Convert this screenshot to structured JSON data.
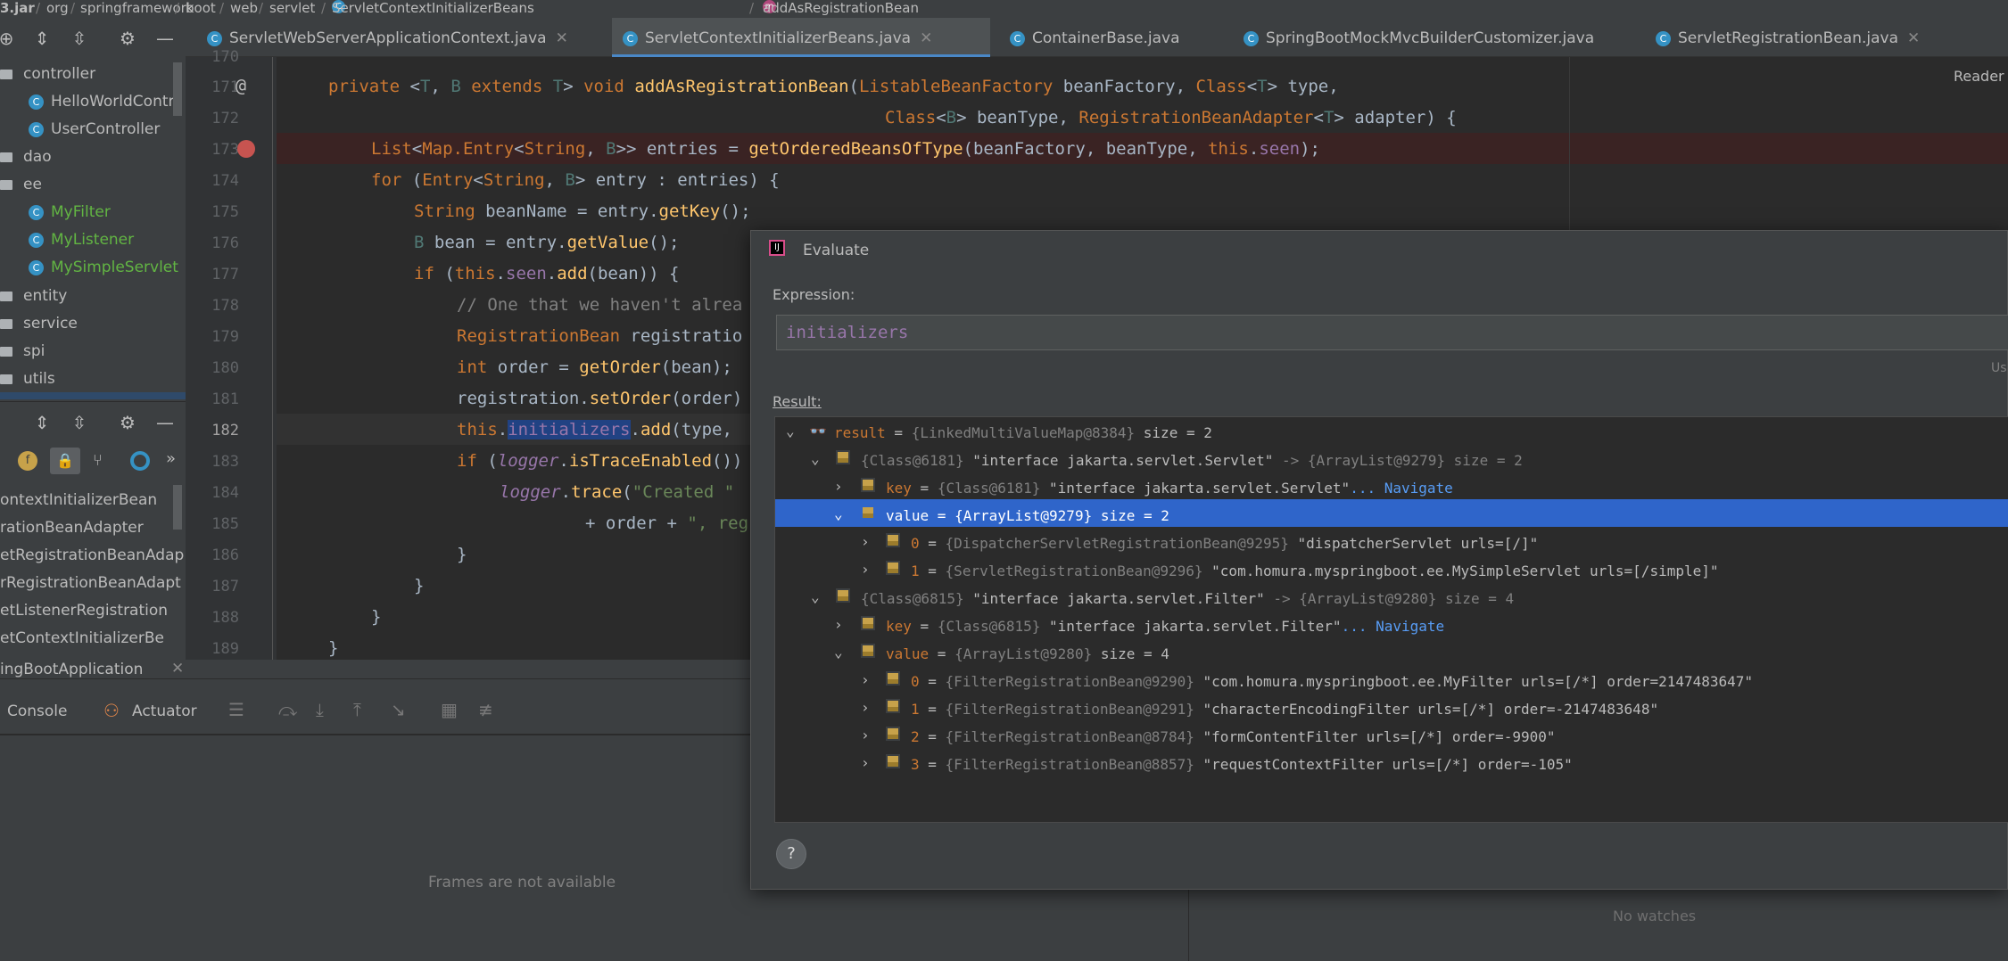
{
  "breadcrumb": {
    "items": [
      "3.jar",
      "org",
      "springframework",
      "boot",
      "web",
      "servlet",
      "ServletContextInitializerBeans",
      "addAsRegistrationBean"
    ]
  },
  "tabs": [
    {
      "label": "ServletWebServerApplicationContext.java"
    },
    {
      "label": "ServletContextInitializerBeans.java"
    },
    {
      "label": "ContainerBase.java"
    },
    {
      "label": "SpringBootMockMvcBuilderCustomizer.java"
    },
    {
      "label": "ServletRegistrationBean.java"
    }
  ],
  "project_tree": {
    "items": [
      {
        "label": "controller",
        "kind": "folder"
      },
      {
        "label": "HelloWorldContr",
        "kind": "class"
      },
      {
        "label": "UserController",
        "kind": "class"
      },
      {
        "label": "dao",
        "kind": "folder"
      },
      {
        "label": "ee",
        "kind": "folder"
      },
      {
        "label": "MyFilter",
        "kind": "class"
      },
      {
        "label": "MyListener",
        "kind": "class"
      },
      {
        "label": "MySimpleServlet",
        "kind": "class"
      },
      {
        "label": "entity",
        "kind": "folder"
      },
      {
        "label": "service",
        "kind": "folder"
      },
      {
        "label": "spi",
        "kind": "folder"
      },
      {
        "label": "utils",
        "kind": "folder"
      }
    ]
  },
  "structure": {
    "items": [
      "ontextInitializerBean",
      "rationBeanAdapter",
      "etRegistrationBeanAdap",
      "rRegistrationBeanAdapt",
      "etListenerRegistration",
      "etContextInitializerBe"
    ]
  },
  "editor": {
    "line_numbers": [
      "170",
      "171",
      "172",
      "173",
      "174",
      "175",
      "176",
      "177",
      "178",
      "179",
      "180",
      "181",
      "182",
      "183",
      "184",
      "185",
      "186",
      "187",
      "188",
      "189"
    ],
    "reader_mode": "Reader"
  },
  "run": {
    "tab": "ingBootApplication",
    "console": "Console",
    "actuator": "Actuator",
    "frames_msg": "Frames are not available",
    "watches_msg": "No watches"
  },
  "evaluate": {
    "title": "Evaluate",
    "expression_label": "Expression:",
    "expression": "initializers",
    "use_hint": "Us",
    "result_label": "Result:",
    "rows": [
      {
        "name": "result",
        "eq": " = ",
        "type": "{LinkedMultiValueMap@8384}",
        "value": "",
        "extra": " size = 2"
      },
      {
        "name": "",
        "eq": "",
        "type": "{Class@6181}",
        "value": " \"interface jakarta.servlet.Servlet\"",
        "extra": " -> {ArrayList@9279}  size = 2"
      },
      {
        "name": "key",
        "eq": " = ",
        "type": "{Class@6181}",
        "value": " \"interface jakarta.servlet.Servlet\"",
        "extra": "... Navigate"
      },
      {
        "name": "value",
        "eq": " = ",
        "type": "{ArrayList@9279}",
        "value": "",
        "extra": "  size = 2"
      },
      {
        "name": "0",
        "eq": " = ",
        "type": "{DispatcherServletRegistrationBean@9295}",
        "value": " \"dispatcherServlet urls=[/]\"",
        "extra": ""
      },
      {
        "name": "1",
        "eq": " = ",
        "type": "{ServletRegistrationBean@9296}",
        "value": " \"com.homura.myspringboot.ee.MySimpleServlet urls=[/simple]\"",
        "extra": ""
      },
      {
        "name": "",
        "eq": "",
        "type": "{Class@6815}",
        "value": " \"interface jakarta.servlet.Filter\"",
        "extra": " -> {ArrayList@9280}  size = 4"
      },
      {
        "name": "key",
        "eq": " = ",
        "type": "{Class@6815}",
        "value": " \"interface jakarta.servlet.Filter\"",
        "extra": "... Navigate"
      },
      {
        "name": "value",
        "eq": " = ",
        "type": "{ArrayList@9280}",
        "value": "",
        "extra": "  size = 4"
      },
      {
        "name": "0",
        "eq": " = ",
        "type": "{FilterRegistrationBean@9290}",
        "value": " \"com.homura.myspringboot.ee.MyFilter urls=[/*] order=2147483647\"",
        "extra": ""
      },
      {
        "name": "1",
        "eq": " = ",
        "type": "{FilterRegistrationBean@9291}",
        "value": " \"characterEncodingFilter urls=[/*] order=-2147483648\"",
        "extra": ""
      },
      {
        "name": "2",
        "eq": " = ",
        "type": "{FilterRegistrationBean@8784}",
        "value": " \"formContentFilter urls=[/*] order=-9900\"",
        "extra": ""
      },
      {
        "name": "3",
        "eq": " = ",
        "type": "{FilterRegistrationBean@8857}",
        "value": " \"requestContextFilter urls=[/*] order=-105\"",
        "extra": ""
      }
    ],
    "help": "?"
  }
}
